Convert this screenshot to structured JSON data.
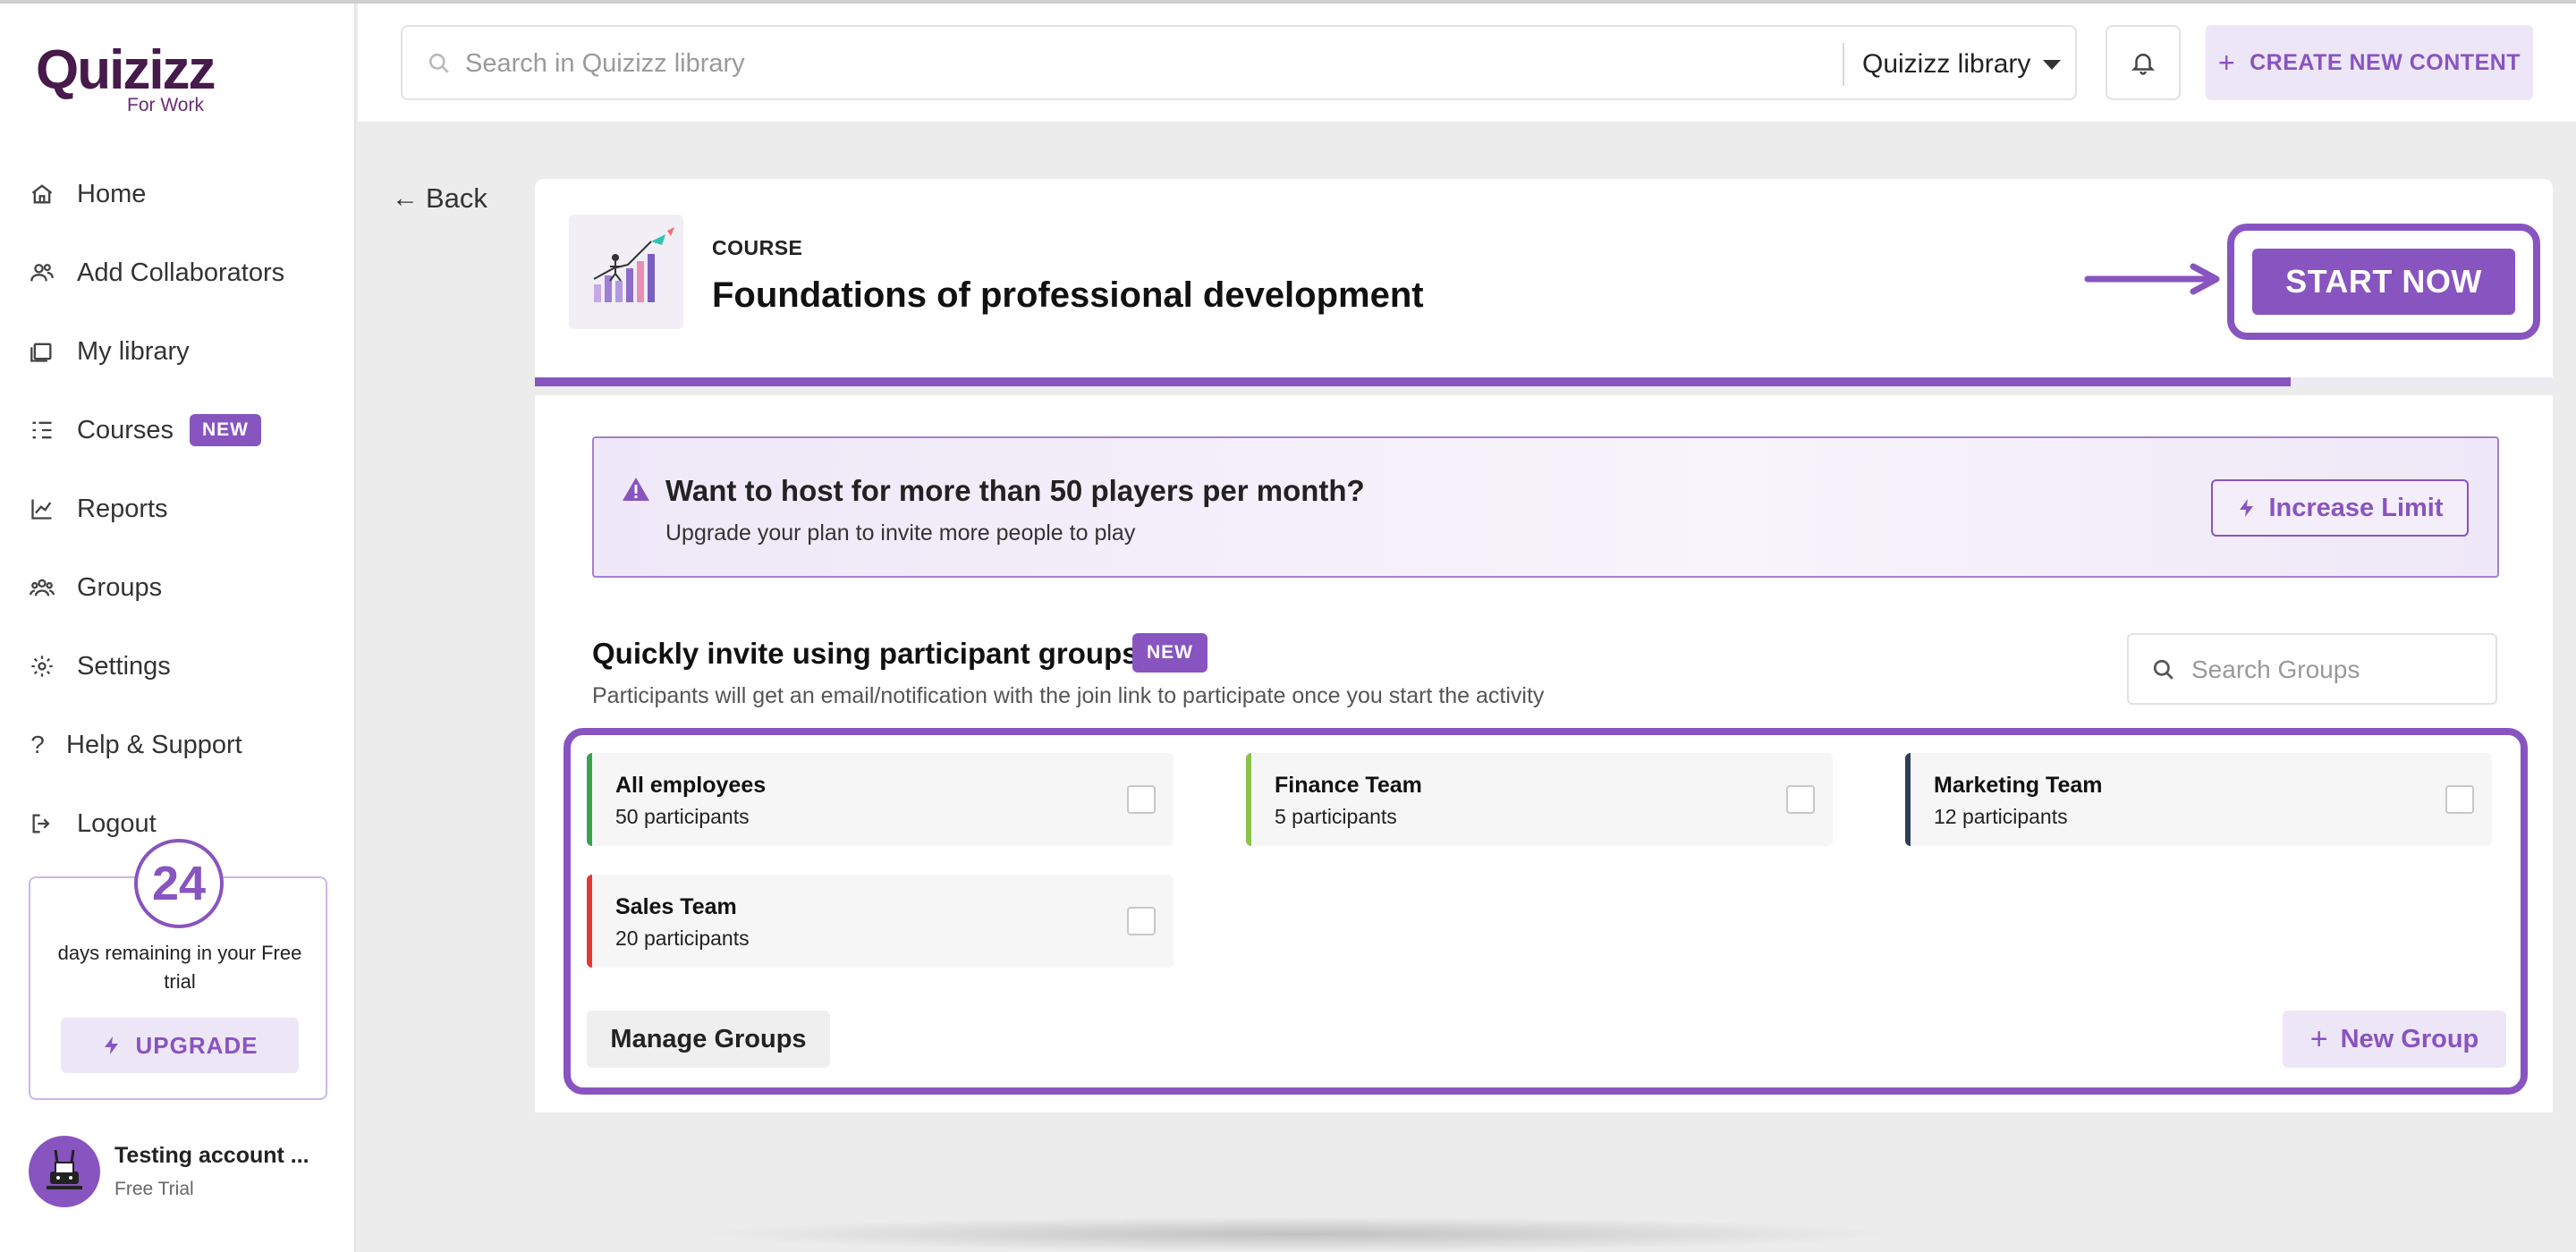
{
  "brand": {
    "logo_text": "Quizizz",
    "logo_sub": "For Work",
    "accent": "#8854c0"
  },
  "sidebar": {
    "items": [
      {
        "label": "Home",
        "icon": "home-icon"
      },
      {
        "label": "Add Collaborators",
        "icon": "collaborators-icon"
      },
      {
        "label": "My library",
        "icon": "library-icon"
      },
      {
        "label": "Courses",
        "icon": "courses-icon",
        "badge": "NEW"
      },
      {
        "label": "Reports",
        "icon": "reports-icon"
      },
      {
        "label": "Groups",
        "icon": "groups-icon"
      },
      {
        "label": "Settings",
        "icon": "gear-icon"
      },
      {
        "label": "Help & Support",
        "icon": "question-icon"
      },
      {
        "label": "Logout",
        "icon": "logout-icon"
      }
    ],
    "trial": {
      "days": "24",
      "text": "days remaining in your Free trial",
      "upgrade_label": "UPGRADE"
    },
    "account": {
      "name": "Testing account ...",
      "plan": "Free Trial"
    }
  },
  "topbar": {
    "search_placeholder": "Search in Quizizz library",
    "library_select": "Quizizz library",
    "create_label": "CREATE NEW CONTENT"
  },
  "back_label": "Back",
  "course": {
    "label": "COURSE",
    "title": "Foundations of professional development",
    "progress": 0.87,
    "start_label": "START NOW"
  },
  "limit_banner": {
    "title": "Want to host for more than 50 players per month?",
    "subtitle": "Upgrade your plan to invite more people to play",
    "button_label": "Increase Limit"
  },
  "invite": {
    "title": "Quickly invite using participant groups",
    "badge": "NEW",
    "subtitle": "Participants will get an email/notification with the join link to participate once you start the activity",
    "search_placeholder": "Search Groups",
    "groups": [
      {
        "name": "All employees",
        "count": "50 participants",
        "color": "#3aa24a"
      },
      {
        "name": "Finance Team",
        "count": "5 participants",
        "color": "#8ac24a"
      },
      {
        "name": "Marketing Team",
        "count": "12 participants",
        "color": "#2c3e5a"
      },
      {
        "name": "Sales Team",
        "count": "20 participants",
        "color": "#e53935"
      }
    ],
    "manage_label": "Manage Groups",
    "new_group_label": "New Group"
  }
}
